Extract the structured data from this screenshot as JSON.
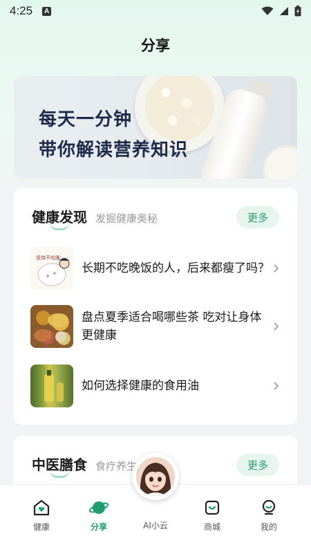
{
  "status": {
    "time": "4:25",
    "notification_letter": "A"
  },
  "page": {
    "title": "分享"
  },
  "banner": {
    "line1": "每天一分钟",
    "line2": "带你解读营养知识"
  },
  "discover": {
    "title": "健康发现",
    "subtitle": "发掘健康奥秘",
    "more_label": "更多",
    "articles": [
      {
        "title": "长期不吃晚饭的人，后来都瘦了吗？",
        "thumb_text": "坚持不吃晚"
      },
      {
        "title": "盘点夏季适合喝哪些茶 吃对让身体更健康"
      },
      {
        "title": "如何选择健康的食用油"
      }
    ]
  },
  "tcm": {
    "title": "中医膳食",
    "subtitle": "食疗养生",
    "more_label": "更多"
  },
  "tabbar": {
    "items": [
      {
        "label": "健康",
        "icon": "house-heart-icon"
      },
      {
        "label": "分享",
        "icon": "planet-icon",
        "active": true
      },
      {
        "label": "AI小云",
        "icon": "ai-avatar"
      },
      {
        "label": "商城",
        "icon": "shopping-bag-icon"
      },
      {
        "label": "我的",
        "icon": "profile-icon"
      }
    ]
  },
  "colors": {
    "accent": "#1f9f71",
    "accent_light": "#e6f5ee",
    "banner_text": "#1e2a4a"
  }
}
